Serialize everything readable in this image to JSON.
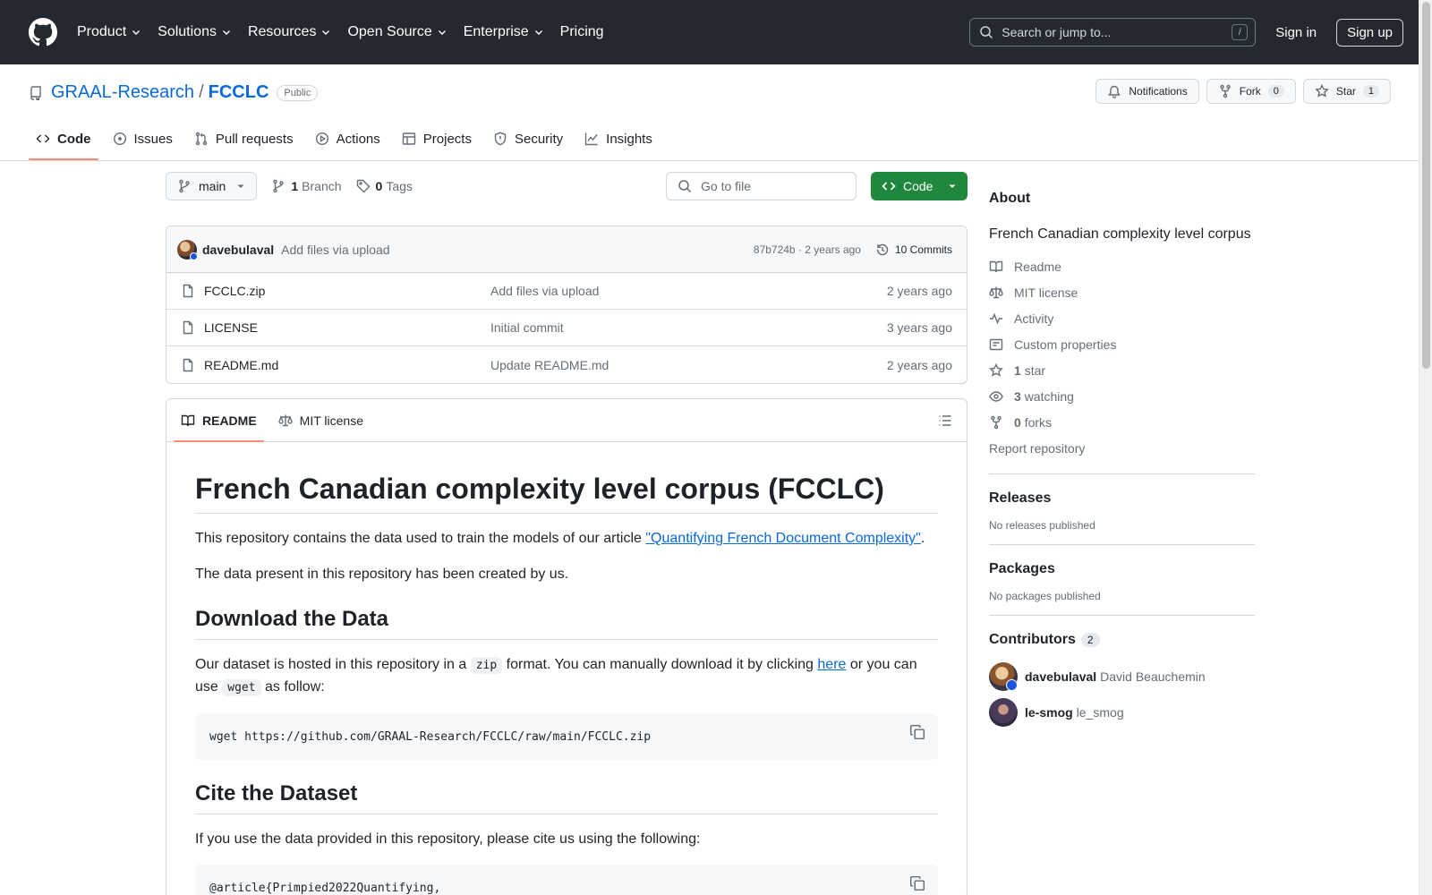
{
  "header": {
    "nav": [
      {
        "label": "Product",
        "chevron": true
      },
      {
        "label": "Solutions",
        "chevron": true
      },
      {
        "label": "Resources",
        "chevron": true
      },
      {
        "label": "Open Source",
        "chevron": true
      },
      {
        "label": "Enterprise",
        "chevron": true
      },
      {
        "label": "Pricing",
        "chevron": false
      }
    ],
    "search_placeholder": "Search or jump to...",
    "search_shortcut": "/",
    "sign_in": "Sign in",
    "sign_up": "Sign up"
  },
  "repo": {
    "owner": "GRAAL-Research",
    "separator": "/",
    "name": "FCCLC",
    "visibility": "Public",
    "notifications_label": "Notifications",
    "fork_label": "Fork",
    "fork_count": "0",
    "star_label": "Star",
    "star_count": "1"
  },
  "tabs": [
    {
      "label": "Code",
      "icon": "code-icon",
      "active": true
    },
    {
      "label": "Issues",
      "icon": "issue-icon",
      "active": false
    },
    {
      "label": "Pull requests",
      "icon": "pull-request-icon",
      "active": false
    },
    {
      "label": "Actions",
      "icon": "play-icon",
      "active": false
    },
    {
      "label": "Projects",
      "icon": "table-icon",
      "active": false
    },
    {
      "label": "Security",
      "icon": "shield-icon",
      "active": false
    },
    {
      "label": "Insights",
      "icon": "graph-icon",
      "active": false
    }
  ],
  "toolbar": {
    "branch": "main",
    "branch_count": "1",
    "branch_label": "Branch",
    "tag_count": "0",
    "tag_label": "Tags",
    "goto_placeholder": "Go to file",
    "code_button": "Code"
  },
  "last_commit": {
    "author": "davebulaval",
    "message": "Add files via upload",
    "sha_time": "87b724b · 2 years ago",
    "commits": "10 Commits"
  },
  "files": [
    {
      "name": "FCCLC.zip",
      "message": "Add files via upload",
      "age": "2 years ago"
    },
    {
      "name": "LICENSE",
      "message": "Initial commit",
      "age": "3 years ago"
    },
    {
      "name": "README.md",
      "message": "Update README.md",
      "age": "2 years ago"
    }
  ],
  "readme": {
    "tab_readme": "README",
    "tab_license": "MIT license",
    "title": "French Canadian complexity level corpus (FCCLC)",
    "p1_before": "This repository contains the data used to train the models of our article ",
    "p1_link": "\"Quantifying French Document Complexity\"",
    "p1_after": ".",
    "p2": "The data present in this repository has been created by us.",
    "h_download": "Download the Data",
    "p3_a": "Our dataset is hosted in this repository in a ",
    "p3_code1": "zip",
    "p3_b": " format. You can manually download it by clicking ",
    "p3_link": "here",
    "p3_c": " or you can use ",
    "p3_code2": "wget",
    "p3_d": " as follow:",
    "code_wget": "wget https://github.com/GRAAL-Research/FCCLC/raw/main/FCCLC.zip",
    "h_cite": "Cite the Dataset",
    "p4": "If you use the data provided in this repository, please cite us using the following:",
    "code_cite": "@article{Primpied2022Quantifying,"
  },
  "about": {
    "title": "About",
    "description": "French Canadian complexity level corpus",
    "items": [
      {
        "icon": "book-icon",
        "bold": "",
        "label": "Readme"
      },
      {
        "icon": "law-icon",
        "bold": "",
        "label": "MIT license"
      },
      {
        "icon": "pulse-icon",
        "bold": "",
        "label": "Activity"
      },
      {
        "icon": "note-icon",
        "bold": "",
        "label": "Custom properties"
      },
      {
        "icon": "star-icon",
        "bold": "1",
        "label": "star"
      },
      {
        "icon": "eye-icon",
        "bold": "3",
        "label": "watching"
      },
      {
        "icon": "fork-icon",
        "bold": "0",
        "label": "forks"
      }
    ],
    "report": "Report repository"
  },
  "releases": {
    "title": "Releases",
    "empty": "No releases published"
  },
  "packages": {
    "title": "Packages",
    "empty": "No packages published"
  },
  "contributors": {
    "title": "Contributors",
    "count": "2",
    "list": [
      {
        "login": "davebulaval",
        "name": "David Beauchemin"
      },
      {
        "login": "le-smog",
        "name": "le_smog"
      }
    ]
  },
  "colors": {
    "header_bg": "#24292f",
    "link": "#0969da",
    "code_button": "#1f883d",
    "active_tab": "#fd8c73"
  }
}
